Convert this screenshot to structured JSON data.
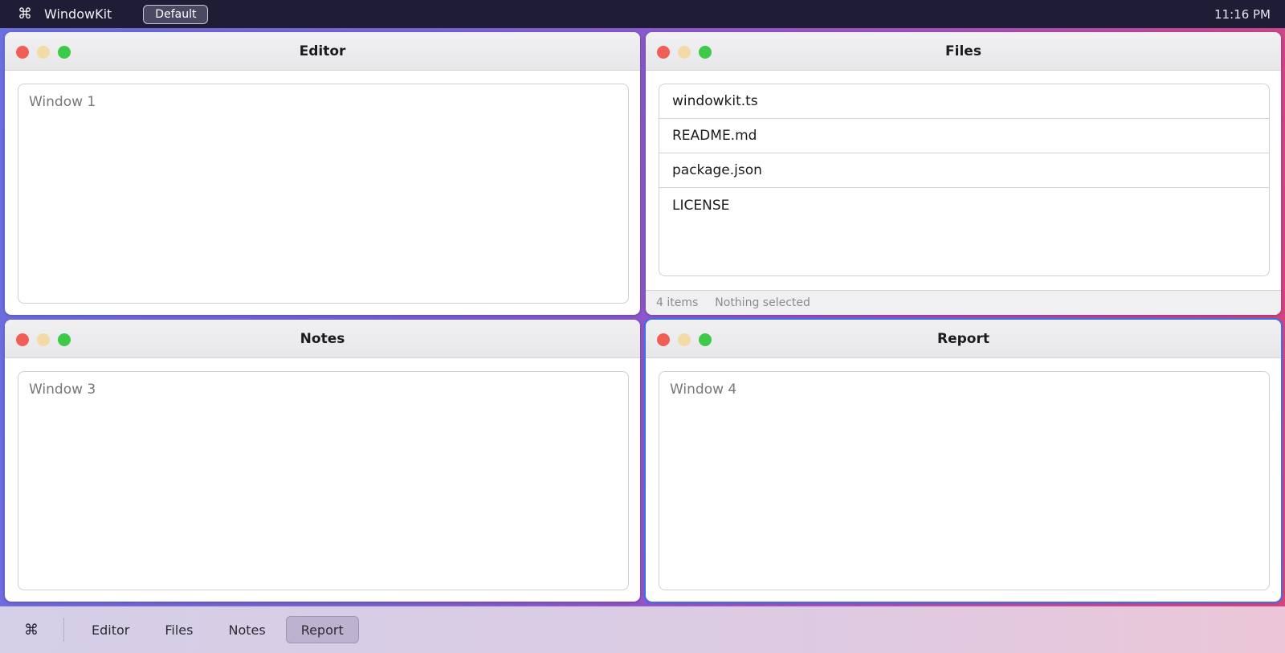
{
  "menubar": {
    "cmd_glyph": "⌘",
    "app_name": "WindowKit",
    "layout_label": "Default",
    "clock": "11:16 PM"
  },
  "windows": {
    "editor": {
      "title": "Editor",
      "content": "Window 1"
    },
    "files": {
      "title": "Files",
      "items": [
        "windowkit.ts",
        "README.md",
        "package.json",
        "LICENSE"
      ],
      "status_count": "4 items",
      "status_selection": "Nothing selected"
    },
    "notes": {
      "title": "Notes",
      "content": "Window 3"
    },
    "report": {
      "title": "Report",
      "content": "Window 4",
      "active": true
    }
  },
  "dock": {
    "cmd_glyph": "⌘",
    "items": [
      {
        "label": "Editor",
        "active": false
      },
      {
        "label": "Files",
        "active": false
      },
      {
        "label": "Notes",
        "active": false
      },
      {
        "label": "Report",
        "active": true
      }
    ]
  },
  "colors": {
    "traffic_close": "#f05f57",
    "traffic_minimize": "#f2dba6",
    "traffic_maximize": "#3ec94b",
    "active_window_outline": "#3d6fe8",
    "menubar_bg": "#1f1d36"
  }
}
